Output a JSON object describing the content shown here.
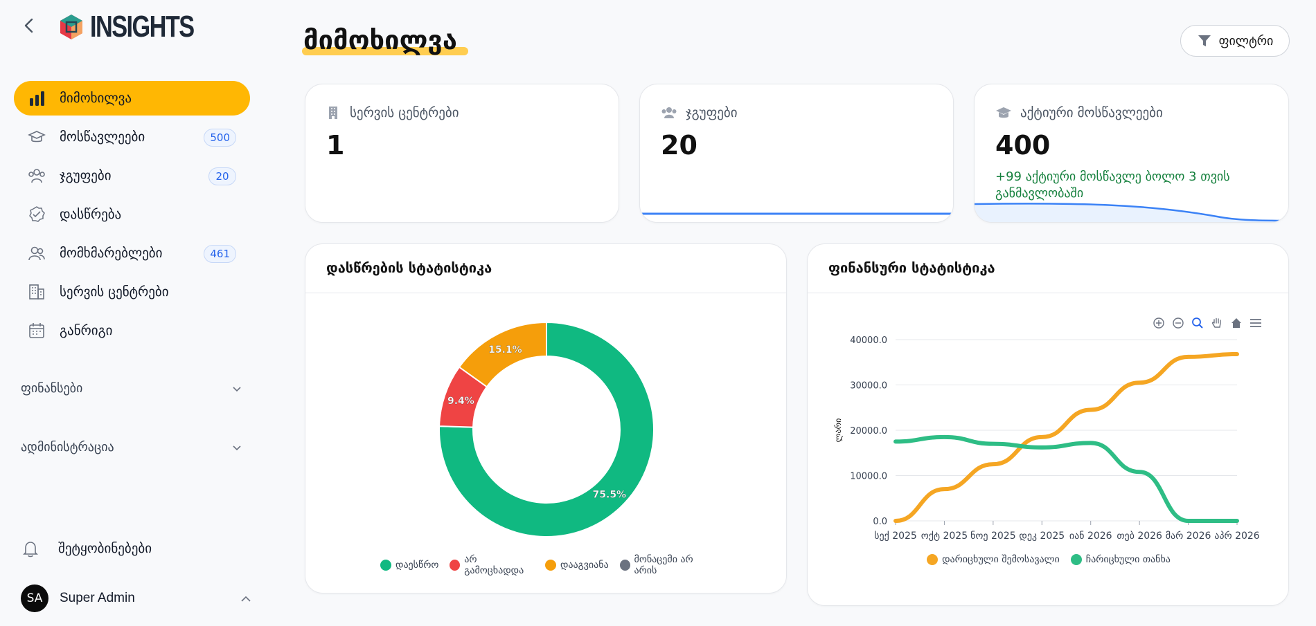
{
  "logo": {
    "text": "INSIGHTS"
  },
  "nav": {
    "items": [
      {
        "label": "მიმოხილვა",
        "badge": "",
        "icon": "bar-chart-icon",
        "active": true
      },
      {
        "label": "მოსწავლეები",
        "badge": "500",
        "icon": "graduation-cap-icon"
      },
      {
        "label": "ჯგუფები",
        "badge": "20",
        "icon": "users-group-icon"
      },
      {
        "label": "დასწრება",
        "badge": "",
        "icon": "check-badge-icon"
      },
      {
        "label": "მომხმარებლები",
        "badge": "461",
        "icon": "user-icon"
      },
      {
        "label": "სერვის ცენტრები",
        "badge": "",
        "icon": "building-icon"
      },
      {
        "label": "განრიგი",
        "badge": "",
        "icon": "calendar-icon"
      }
    ],
    "sections": [
      {
        "label": "ფინანსები"
      },
      {
        "label": "ადმინისტრაცია"
      }
    ],
    "notifications": "შეტყობინებები",
    "user": {
      "initials": "SA",
      "name": "Super Admin"
    }
  },
  "header": {
    "title": "მიმოხილვა",
    "filter_label": "ფილტრი"
  },
  "stats": [
    {
      "title": "სერვის ცენტრები",
      "value": "1",
      "icon": "building-icon"
    },
    {
      "title": "ჯგუფები",
      "value": "20",
      "icon": "users-group-icon"
    },
    {
      "title": "აქტიური მოსწავლეები",
      "value": "400",
      "icon": "graduation-cap-icon",
      "note": "+99 აქტიური მოსწავლე ბოლო 3 თვის განმავლობაში"
    }
  ],
  "attendance": {
    "title": "დასწრების სტატისტიკა",
    "chart_data": {
      "type": "pie",
      "slices": [
        {
          "label": "დაესწრო",
          "value": 75.5,
          "display": "75.5%",
          "color": "#10b981"
        },
        {
          "label": "არ გამოცხადდა",
          "value": 9.4,
          "display": "9.4%",
          "color": "#ef4444"
        },
        {
          "label": "დააგვიანა",
          "value": 15.1,
          "display": "15.1%",
          "color": "#f59e0b"
        },
        {
          "label": "მონაცემი არ არის",
          "value": 0,
          "display": "",
          "color": "#6b7280"
        }
      ]
    }
  },
  "finance": {
    "title": "ფინანსური სტატისტიკა",
    "chart_data": {
      "type": "line",
      "categories": [
        "სექ 2025",
        "ოქტ 2025",
        "ნოე 2025",
        "დეკ 2025",
        "იან 2026",
        "თებ 2026",
        "მარ 2026",
        "აპრ 2026"
      ],
      "ylabel": "ლარი",
      "ylim": [
        0,
        40000
      ],
      "yticks": [
        "0.0",
        "10000.0",
        "20000.0",
        "30000.0",
        "40000.0"
      ],
      "series": [
        {
          "name": "დარიცხული შემოსავალი",
          "color": "#f5a623",
          "values": [
            0,
            7000,
            12500,
            18500,
            24500,
            30500,
            36200,
            36800
          ]
        },
        {
          "name": "ჩარიცხული თანხა",
          "color": "#2ebd85",
          "values": [
            17500,
            18500,
            17000,
            16200,
            17200,
            10800,
            0,
            0
          ]
        }
      ]
    }
  }
}
